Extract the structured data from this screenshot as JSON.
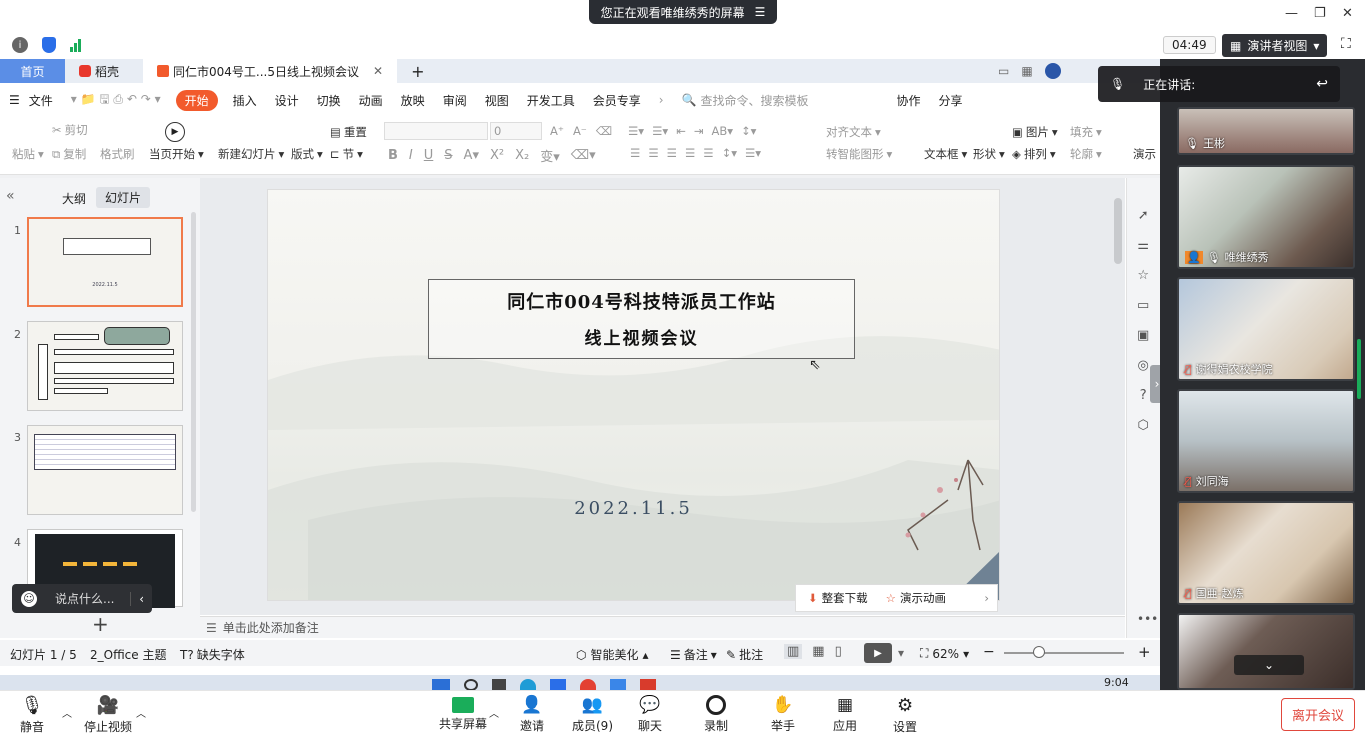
{
  "banner": {
    "text": "您正在观看唯维绣秀的屏幕"
  },
  "meeting": {
    "time": "04:49",
    "view_mode": "演讲者视图"
  },
  "tabs": {
    "home": "首页",
    "straw": "稻壳",
    "doc": "同仁市004号工...5日线上视频会议"
  },
  "menu": {
    "file": "文件",
    "start": "开始",
    "insert": "插入",
    "design": "设计",
    "transition": "切换",
    "animation": "动画",
    "slideshow": "放映",
    "review": "审阅",
    "view": "视图",
    "devtools": "开发工具",
    "vip": "会员专享",
    "search_placeholder": "查找命令、搜索模板",
    "collab": "协作",
    "share": "分享"
  },
  "ribbon": {
    "paste": "粘贴",
    "cut": "剪切",
    "copy": "复制",
    "format_painter": "格式刷",
    "play_current": "当页开始",
    "new_slide": "新建幻灯片",
    "layout": "版式",
    "section": "节",
    "reset": "重置",
    "font_size": "0",
    "align_text": "对齐文本",
    "smartart": "转智能图形",
    "textbox": "文本框",
    "shape": "形状",
    "image": "图片",
    "arrange": "排列",
    "fill": "填充",
    "outline": "轮廓",
    "play": "演示"
  },
  "panel": {
    "outline_tab": "大纲",
    "slides_tab": "幻灯片",
    "thumb_nums": [
      "1",
      "2",
      "3",
      "4"
    ]
  },
  "slide": {
    "title_line1": "同仁市004号科技特派员工作站",
    "title_line2": "线上视频会议",
    "date": "2022.11.5"
  },
  "float": {
    "download": "整套下载",
    "animation": "演示动画"
  },
  "chat": {
    "placeholder": "说点什么..."
  },
  "notes": {
    "placeholder": "单击此处添加备注"
  },
  "status": {
    "slide_pos": "幻灯片 1 / 5",
    "theme": "2_Office 主题",
    "missing_font": "缺失字体",
    "beautify": "智能美化",
    "notes": "备注",
    "comment": "批注",
    "zoom": "62%"
  },
  "taskbar": {
    "time": "9:04"
  },
  "speaking": {
    "label": "正在讲话:"
  },
  "participants": [
    {
      "name": "王彬",
      "muted": false
    },
    {
      "name": "唯维绣秀",
      "muted": false
    },
    {
      "name": "谢得娟农校学院",
      "muted": true
    },
    {
      "name": "刘同海",
      "muted": true
    },
    {
      "name": "国亜-赵炼",
      "muted": true
    }
  ],
  "bottom": {
    "mute": "静音",
    "stop_video": "停止视频",
    "share_screen": "共享屏幕",
    "invite": "邀请",
    "members": "成员(9)",
    "chat": "聊天",
    "record": "录制",
    "raise_hand": "举手",
    "apps": "应用",
    "settings": "设置",
    "leave": "离开会议"
  },
  "colors": {
    "accent": "#f25a2c",
    "tab_home": "#5b8ee6",
    "leave": "#e0473c",
    "share_green": "#1aad5a"
  }
}
